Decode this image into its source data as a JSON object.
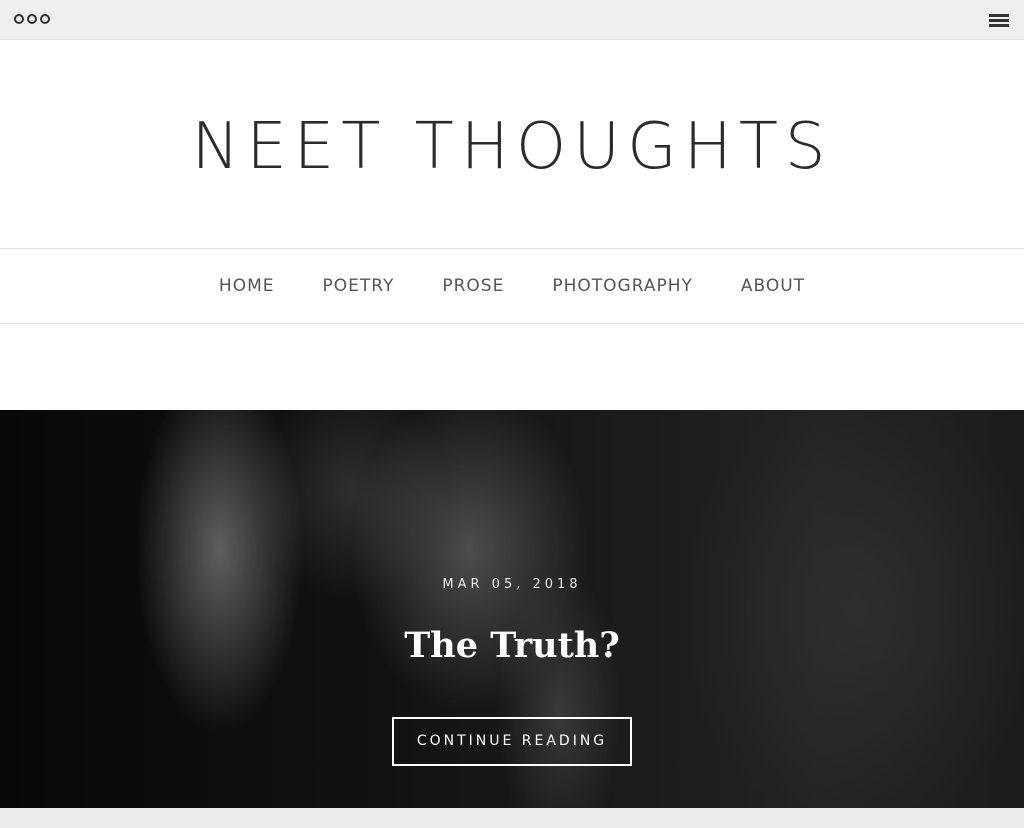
{
  "topbar": {
    "left_icon": "more-dots-icon",
    "right_icon": "hamburger-menu-icon"
  },
  "site": {
    "title": "NEET THOUGHTS"
  },
  "nav": {
    "items": [
      {
        "label": "HOME"
      },
      {
        "label": "POETRY"
      },
      {
        "label": "PROSE"
      },
      {
        "label": "PHOTOGRAPHY"
      },
      {
        "label": "ABOUT"
      }
    ]
  },
  "featured_post": {
    "date": "MAR 05, 2018",
    "title": "The Truth?",
    "button_label": "CONTINUE READING"
  }
}
